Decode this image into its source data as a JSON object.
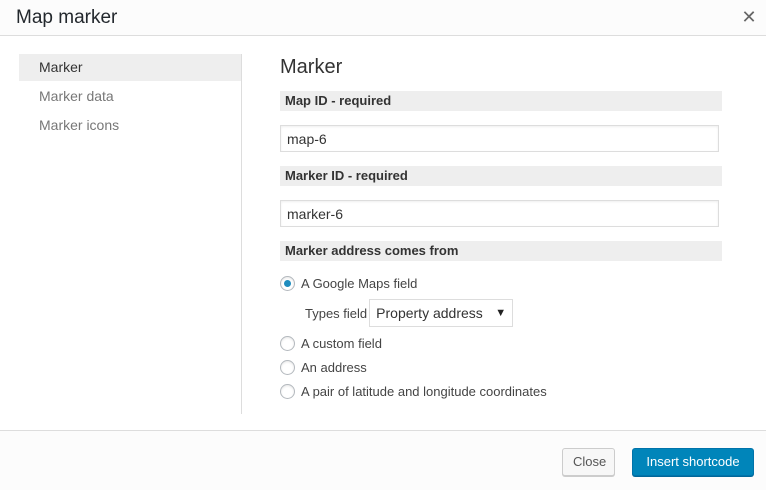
{
  "dialog": {
    "title": "Map marker",
    "close_glyph": "✕"
  },
  "sidebar": {
    "items": [
      {
        "label": "Marker",
        "active": true
      },
      {
        "label": "Marker data",
        "active": false
      },
      {
        "label": "Marker icons",
        "active": false
      }
    ]
  },
  "main": {
    "title": "Marker",
    "map_id": {
      "label": "Map ID - required",
      "value": "map-6"
    },
    "marker_id": {
      "label": "Marker ID - required",
      "value": "marker-6"
    },
    "address_source": {
      "label": "Marker address comes from",
      "options": [
        {
          "label": "A Google Maps field",
          "checked": true
        },
        {
          "label": "A custom field",
          "checked": false
        },
        {
          "label": "An address",
          "checked": false
        },
        {
          "label": "A pair of latitude and longitude coordinates",
          "checked": false
        }
      ],
      "types_field": {
        "label": "Types field",
        "selected": "Property address",
        "arrow": "▼"
      }
    }
  },
  "footer": {
    "close_label": "Close",
    "insert_label": "Insert shortcode"
  },
  "colors": {
    "accent": "#0085ba",
    "radio_dot": "#1e8cbe"
  },
  "icons": {
    "dialog_close": "close-icon",
    "select_arrow": "chevron-down-icon"
  }
}
